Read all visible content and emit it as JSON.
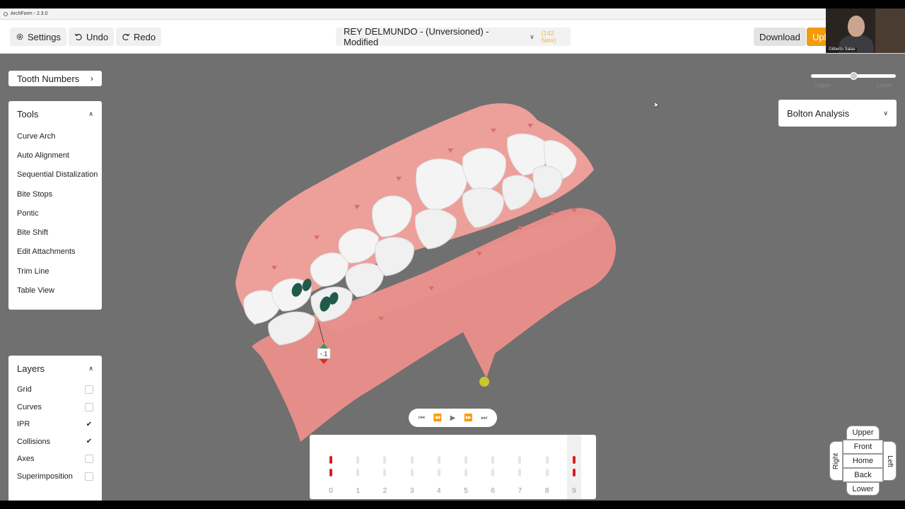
{
  "window": {
    "title": "ArchForm - 2.3.0"
  },
  "toolbar": {
    "settings_label": "Settings",
    "undo_label": "Undo",
    "redo_label": "Redo",
    "case_title": "REY DELMUNDO - (Unversioned) - Modified",
    "new_count": "(142 New)",
    "download_label": "Download",
    "upload_label": "Upl"
  },
  "webcam": {
    "participant_name": "Gilberto Salas"
  },
  "tooth_numbers": {
    "label": "Tooth Numbers"
  },
  "tools": {
    "title": "Tools",
    "items": [
      {
        "label": "Curve Arch"
      },
      {
        "label": "Auto Alignment"
      },
      {
        "label": "Sequential Distalization"
      },
      {
        "label": "Bite Stops"
      },
      {
        "label": "Pontic"
      },
      {
        "label": "Bite Shift"
      },
      {
        "label": "Edit Attachments"
      },
      {
        "label": "Trim Line"
      },
      {
        "label": "Table View"
      }
    ]
  },
  "layers": {
    "title": "Layers",
    "items": [
      {
        "label": "Grid",
        "checked": false
      },
      {
        "label": "Curves",
        "checked": false
      },
      {
        "label": "IPR",
        "checked": true
      },
      {
        "label": "Collisions",
        "checked": true
      },
      {
        "label": "Axes",
        "checked": false
      },
      {
        "label": "Superimposition",
        "checked": false
      }
    ]
  },
  "opacity_slider": {
    "left_label": "Upper",
    "right_label": "Lower",
    "value_fraction": 0.5
  },
  "bolton": {
    "label": "Bolton Analysis"
  },
  "view_cube": {
    "upper": "Upper",
    "front": "Front",
    "home": "Home",
    "back": "Back",
    "lower": "Lower",
    "right": "Right",
    "left": "Left"
  },
  "ipr_marker": {
    "value": "-.1"
  },
  "timeline": {
    "stages": [
      {
        "label": "0",
        "upper_red": true,
        "lower_red": true
      },
      {
        "label": "1",
        "upper_red": false,
        "lower_red": false
      },
      {
        "label": "2",
        "upper_red": false,
        "lower_red": false
      },
      {
        "label": "3",
        "upper_red": false,
        "lower_red": false
      },
      {
        "label": "4",
        "upper_red": false,
        "lower_red": false
      },
      {
        "label": "5",
        "upper_red": false,
        "lower_red": false
      },
      {
        "label": "6",
        "upper_red": false,
        "lower_red": false
      },
      {
        "label": "7",
        "upper_red": false,
        "lower_red": false
      },
      {
        "label": "8",
        "upper_red": false,
        "lower_red": false
      },
      {
        "label": "9",
        "upper_red": true,
        "lower_red": true
      }
    ],
    "current_stage": "9"
  },
  "colors": {
    "gum": "#e9938e",
    "tooth": "#f4f4f4",
    "attachment": "#1f5a4b",
    "upload_accent": "#f29b0c",
    "collision_red": "#d91e1e"
  }
}
